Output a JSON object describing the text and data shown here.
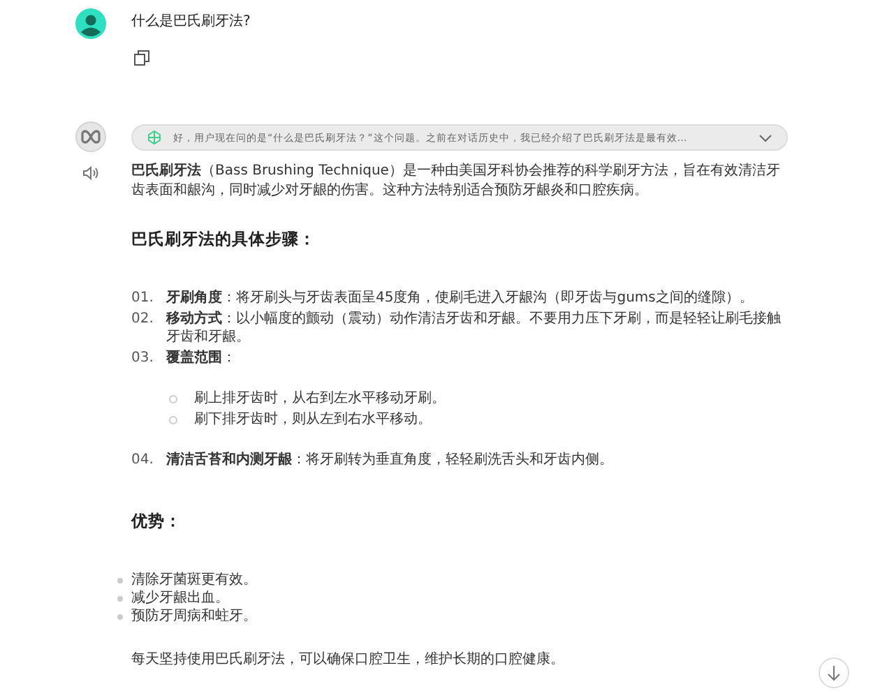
{
  "user_message": {
    "text": "什么是巴氏刷牙法?"
  },
  "thinking": {
    "text": "好，用户现在问的是“什么是巴氏刷牙法？”这个问题。之前在对话历史中，我已经介绍了巴氏刷牙法是最有效…",
    "expanded": false
  },
  "answer": {
    "intro": "**巴氏刷牙法**（Bass Brushing Technique）是一种由美国牙科协会推荐的科学刷牙方法，旨在有效清洁牙齿表面和龈沟，同时减少对牙龈的伤害。这种方法特别适合预防牙龈炎和口腔疾病。",
    "steps_heading": "巴氏刷牙法的具体步骤：",
    "steps": [
      {
        "number": "01.",
        "text": "**牙刷角度**：将牙刷头与牙齿表面呈45度角，使刷毛进入牙龈沟（即牙齿与gums之间的缝隙）。"
      },
      {
        "number": "02.",
        "text": "**移动方式**：以小幅度的颤动（震动）动作清洁牙齿和牙龈。不要用力压下牙刷，而是轻轻让刷毛接触牙齿和牙龈。"
      },
      {
        "number": "03.",
        "text": "**覆盖范围**：",
        "children": [
          "刷上排牙齿时，从右到左水平移动牙刷。",
          "刷下排牙齿时，则从左到右水平移动。"
        ]
      },
      {
        "number": "04.",
        "text": "**清洁舌苔和内测牙龈**：将牙刷转为垂直角度，轻轻刷洗舌头和牙齿内侧。"
      }
    ],
    "benefits_heading": "优势：",
    "benefits": [
      "清除牙菌斑更有效。",
      "减少牙龈出血。",
      "预防牙周病和蛀牙。"
    ],
    "closing": "每天坚持使用巴氏刷牙法，可以确保口腔卫生，维护长期的口腔健康。"
  }
}
